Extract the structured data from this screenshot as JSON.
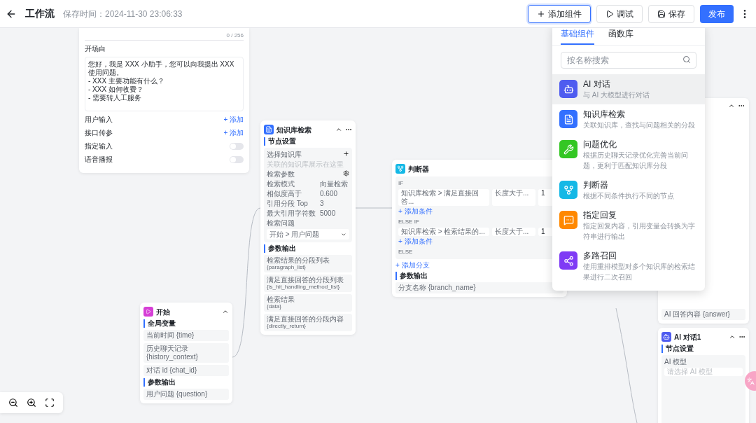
{
  "header": {
    "title": "工作流",
    "save_time": "保存时间：2024-11-30 23:06:33",
    "buttons": [
      {
        "kind": "add",
        "label": "添加组件",
        "active": true
      },
      {
        "kind": "debug",
        "label": "调试",
        "active": false
      },
      {
        "kind": "save",
        "label": "保存",
        "active": false
      },
      {
        "kind": "publish",
        "label": "发布",
        "active": false
      }
    ]
  },
  "base_node": {
    "counter": "0 / 256",
    "intro_label": "开场白",
    "intro_lines": [
      "您好，我是 XXX 小助手，您可以向我提出 XXX 使用问题。",
      "- XXX 主要功能有什么？",
      "- XXX 如何收费？",
      "- 需要转人工服务"
    ],
    "rows": [
      {
        "kind": "add",
        "label": "用户输入",
        "action": "+ 添加"
      },
      {
        "kind": "add",
        "label": "接口传参",
        "action": "+ 添加"
      },
      {
        "kind": "switch",
        "label": "指定输入",
        "on": false
      },
      {
        "kind": "switch",
        "label": "语音播报",
        "on": false
      }
    ]
  },
  "knowledge_node": {
    "title": "知识库检索",
    "section": "节点设置",
    "dataset_label": "选择知识库",
    "dataset_placeholder": "关联的知识库展示在这里",
    "params_label": "检索参数",
    "params": [
      {
        "name": "检索模式",
        "value": "向量检索"
      },
      {
        "name": "相似度高于",
        "value": "0.600"
      },
      {
        "name": "引用分段 Top",
        "value": "3"
      },
      {
        "name": "最大引用字符数",
        "value": "5000"
      }
    ],
    "question_label": "检索问题",
    "question_value": "开始 > 用户问题",
    "output_label": "参数输出",
    "outputs": [
      {
        "name": "检索结果的分段列表",
        "key": "{paragraph_list}"
      },
      {
        "name": "满足直接回答的分段列表",
        "key": "{is_hit_handling_method_list}"
      },
      {
        "name": "检索结果",
        "key": "{data}"
      },
      {
        "name": "满足直接回答的分段内容",
        "key": "{directly_return}"
      }
    ]
  },
  "condition_node": {
    "title": "判断器",
    "branches": [
      {
        "label": "IF",
        "field": "知识库检索 > 满足直接回答...",
        "op": "长度大于...",
        "value": "1",
        "add": "+ 添加条件"
      },
      {
        "label": "ELSE IF",
        "field": "知识库检索 > 检索结果的...",
        "op": "长度大于...",
        "value": "1",
        "add": "+ 添加条件"
      }
    ],
    "else_label": "ELSE",
    "add_branch": "+ 添加分支",
    "output_label": "参数输出",
    "output": "分支名称 {branch_name}"
  },
  "start_node": {
    "title": "开始",
    "globals_label": "全局变量",
    "globals": [
      "当前时间 {time}",
      "历史聊天记录 {history_context}",
      "对话 id {chat_id}"
    ],
    "output_label": "参数输出",
    "outputs": [
      "用户问题 {question}"
    ]
  },
  "answer_node": {
    "output": "AI 回答内容 {answer}"
  },
  "ai_chat_node": {
    "title": "AI 对话1",
    "section": "节点设置",
    "model_label": "AI 模型",
    "model_placeholder": "请选择 AI 模型"
  },
  "add_menu": {
    "tabs": [
      {
        "label": "基础组件",
        "selected": true
      },
      {
        "label": "函数库",
        "selected": false
      }
    ],
    "search": {
      "placeholder": "按名称搜索"
    },
    "items": [
      {
        "kind": "ai_chat",
        "title": "AI 对话",
        "desc": "与 AI 大模型进行对话",
        "color": "#4f5cf0",
        "selected": true
      },
      {
        "kind": "knowledge",
        "title": "知识库检索",
        "desc": "关联知识库，查找与问题相关的分段",
        "color": "#3370ff",
        "selected": false
      },
      {
        "kind": "optimize",
        "title": "问题优化",
        "desc": "根据历史聊天记录优化完善当前问题，更利于匹配知识库分段",
        "color": "#34c724",
        "selected": false
      },
      {
        "kind": "condition",
        "title": "判断器",
        "desc": "根据不同条件执行不同的节点",
        "color": "#14b8e6",
        "selected": false
      },
      {
        "kind": "reply",
        "title": "指定回复",
        "desc": "指定回复内容，引用变量会转换为字符串进行输出",
        "color": "#ff8800",
        "selected": false
      },
      {
        "kind": "rerank",
        "title": "多路召回",
        "desc": "使用重排模型对多个知识库的检索结果进行二次召回",
        "color": "#7f3bf5",
        "selected": false
      }
    ]
  }
}
